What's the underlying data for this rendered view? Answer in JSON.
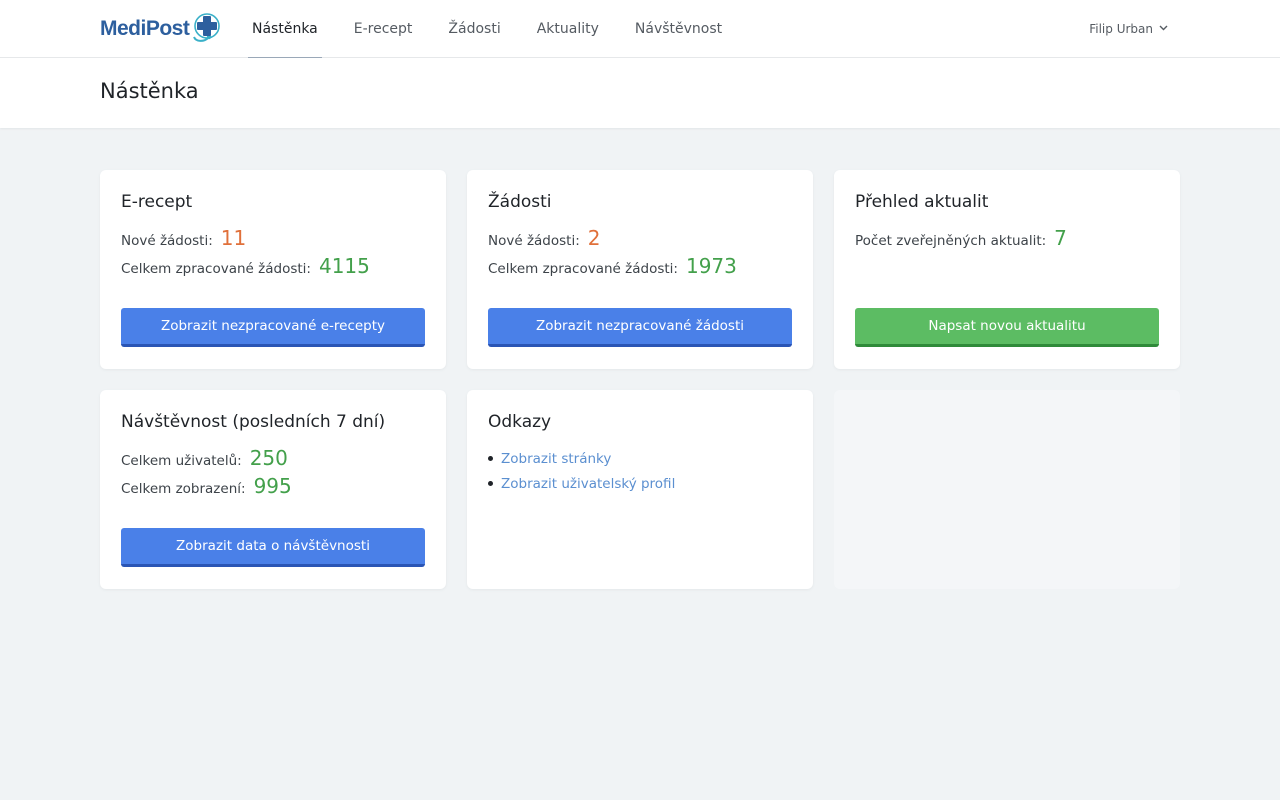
{
  "brand": {
    "name": "MediPost"
  },
  "nav": {
    "items": [
      {
        "label": "Nástěnka"
      },
      {
        "label": "E-recept"
      },
      {
        "label": "Žádosti"
      },
      {
        "label": "Aktuality"
      },
      {
        "label": "Návštěvnost"
      }
    ],
    "user": "Filip Urban"
  },
  "page": {
    "title": "Nástěnka"
  },
  "cards": {
    "erecept": {
      "title": "E-recept",
      "new_label": "Nové žádosti:",
      "new_value": "11",
      "total_label": "Celkem zpracované žádosti:",
      "total_value": "4115",
      "button": "Zobrazit nezpracované e-recepty"
    },
    "zadosti": {
      "title": "Žádosti",
      "new_label": "Nové žádosti:",
      "new_value": "2",
      "total_label": "Celkem zpracované žádosti:",
      "total_value": "1973",
      "button": "Zobrazit nezpracované žádosti"
    },
    "aktuality": {
      "title": "Přehled aktualit",
      "count_label": "Počet zveřejněných aktualit:",
      "count_value": "7",
      "button": "Napsat novou aktualitu"
    },
    "navstevnost": {
      "title": "Návštěvnost (posledních 7 dní)",
      "users_label": "Celkem uživatelů:",
      "users_value": "250",
      "views_label": "Celkem zobrazení:",
      "views_value": "995",
      "button": "Zobrazit data o návštěvnosti"
    },
    "odkazy": {
      "title": "Odkazy",
      "links": [
        {
          "label": "Zobrazit stránky"
        },
        {
          "label": "Zobrazit uživatelský profil"
        }
      ]
    }
  },
  "colors": {
    "primary_button": "#4a80e8",
    "success_button": "#5cbc63",
    "new_count": "#e0703a",
    "total_count": "#43a04b",
    "link": "#5b8fd0"
  }
}
